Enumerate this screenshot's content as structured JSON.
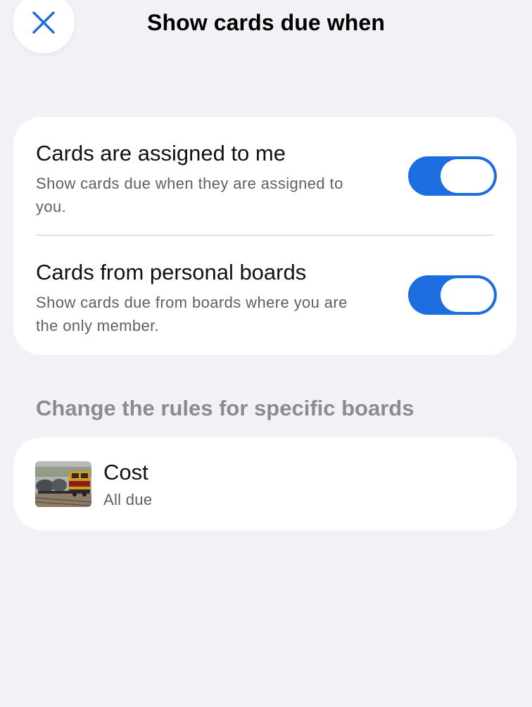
{
  "header": {
    "title": "Show cards due when",
    "close_icon": "close-icon"
  },
  "settings": [
    {
      "title": "Cards are assigned to me",
      "description": "Show cards due when they are assigned to you.",
      "enabled": true
    },
    {
      "title": "Cards from personal boards",
      "description": "Show cards due from boards where you are the only member.",
      "enabled": true
    }
  ],
  "section": {
    "title": "Change the rules for specific boards"
  },
  "boards": [
    {
      "name": "Cost",
      "status": "All due",
      "thumbnail": "train-photo"
    }
  ],
  "colors": {
    "accent": "#1c6ddf",
    "background": "#f1f1f6",
    "card": "#ffffff",
    "secondary_text": "#5f5f66",
    "section_text": "#8b8b90"
  }
}
